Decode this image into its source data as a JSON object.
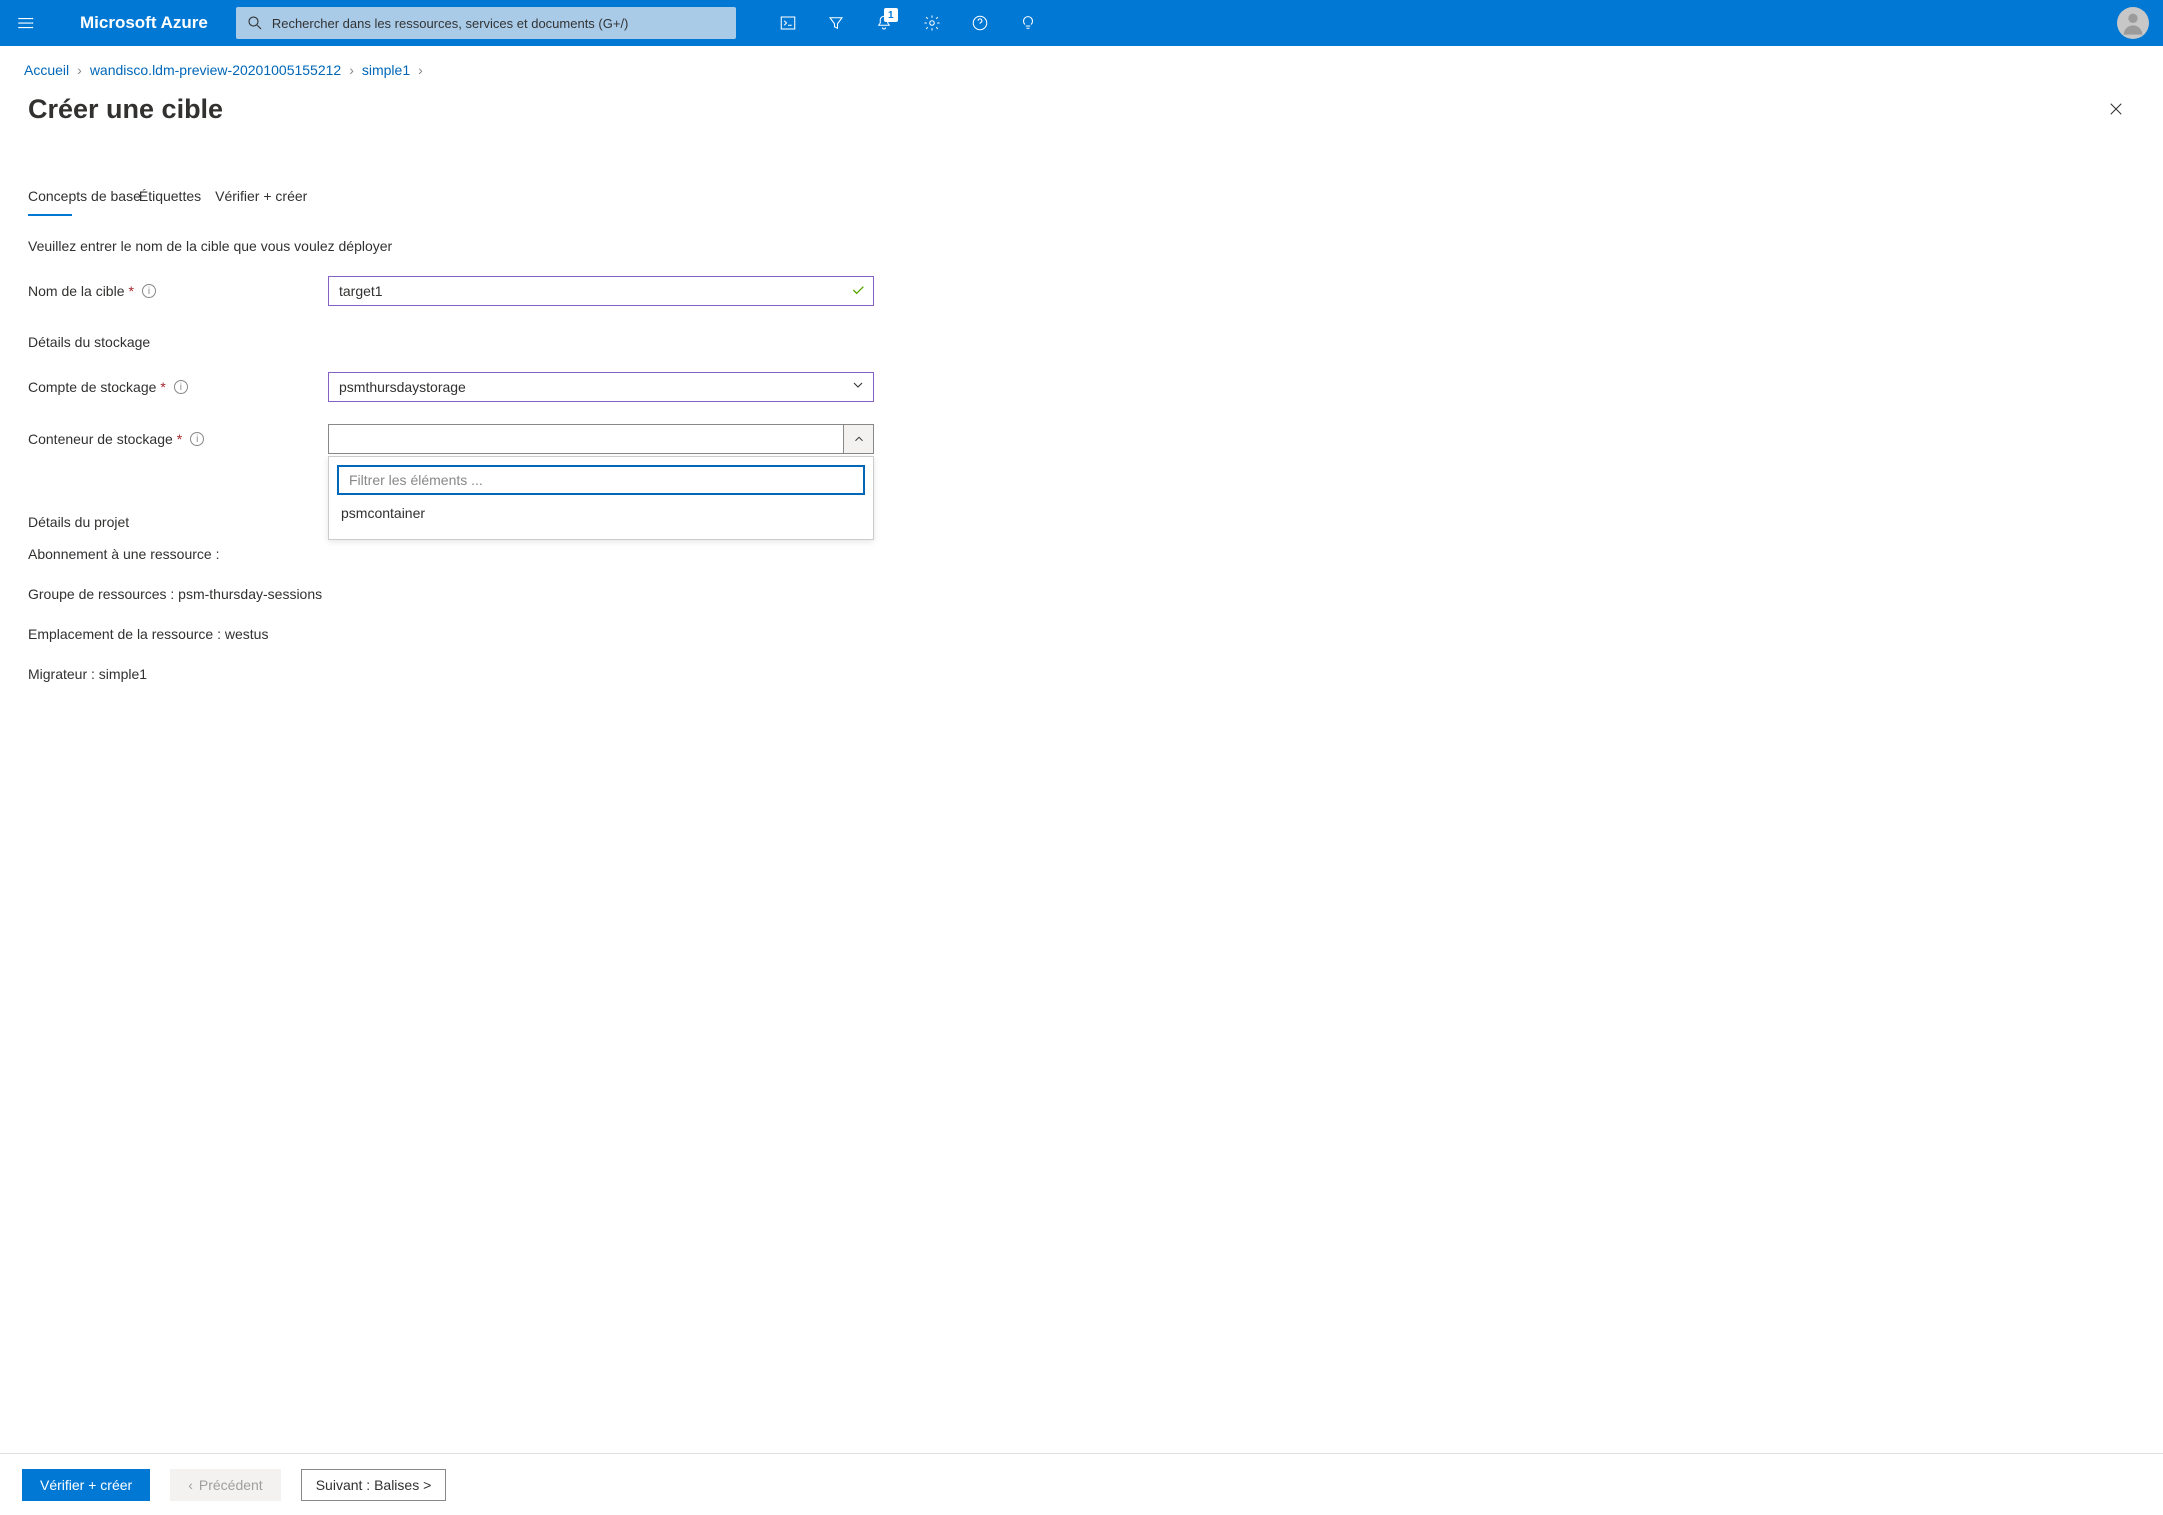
{
  "topbar": {
    "brand": "Microsoft Azure",
    "search_placeholder": "Rechercher dans les ressources, services et documents (G+/)",
    "notification_badge": "1"
  },
  "breadcrumbs": {
    "home": "Accueil",
    "item1": "wandisco.ldm-preview-20201005155212",
    "item2": "simple1"
  },
  "page": {
    "title": "Créer une cible"
  },
  "tabs": {
    "t1": "Concepts de base",
    "t2": "Étiquettes",
    "t3": "Vérifier + créer"
  },
  "form": {
    "instruction": "Veuillez entrer le nom de la cible que vous voulez déployer",
    "target_name_label": "Nom de la cible",
    "target_name_value": "target1",
    "storage_section": "Détails du stockage",
    "storage_account_label": "Compte de stockage",
    "storage_account_value": "psmthursdaystorage",
    "storage_container_label": "Conteneur de stockage",
    "filter_placeholder": "Filtrer les éléments ...",
    "dropdown_option_1": "psmcontainer",
    "project_section": "Détails du projet",
    "subscription_label": "Abonnement à une ressource :",
    "resource_group_line": "Groupe de ressources : psm-thursday-sessions",
    "location_line": "Emplacement de la ressource : westus",
    "migrator_line": "Migrateur : simple1"
  },
  "footer": {
    "verify_create": "Vérifier + créer",
    "previous": "Précédent",
    "next": "Suivant : Balises >"
  }
}
